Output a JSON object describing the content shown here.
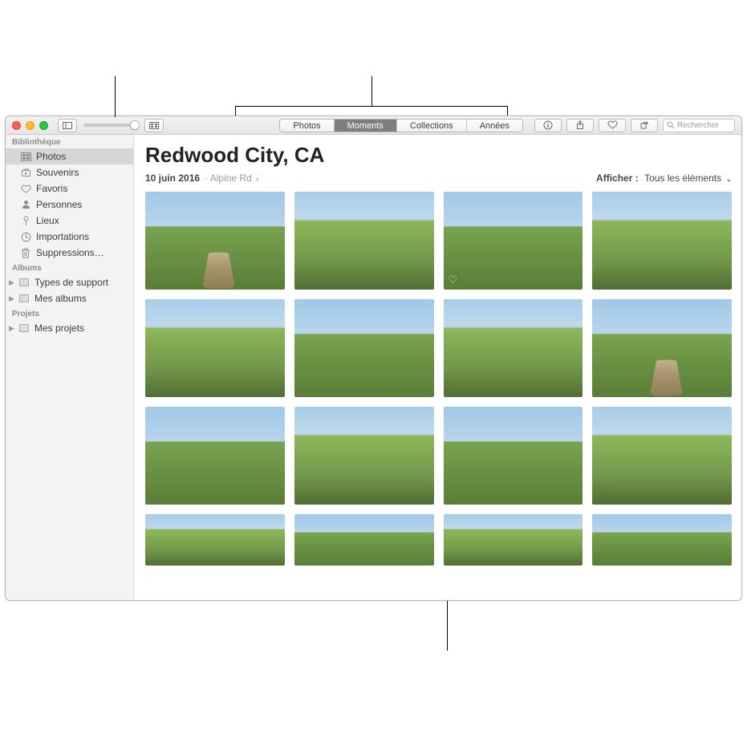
{
  "toolbar": {
    "segments": [
      "Photos",
      "Moments",
      "Collections",
      "Années"
    ],
    "active_segment": 1,
    "search_placeholder": "Rechercher",
    "right_icons": [
      "info-icon",
      "share-icon",
      "favorite-icon",
      "rotate-icon"
    ]
  },
  "sidebar": {
    "sections": [
      {
        "header": "Bibliothèque",
        "items": [
          {
            "label": "Photos",
            "icon": "photos-icon",
            "selected": true
          },
          {
            "label": "Souvenirs",
            "icon": "memories-icon"
          },
          {
            "label": "Favoris",
            "icon": "heart-icon"
          },
          {
            "label": "Personnes",
            "icon": "person-icon"
          },
          {
            "label": "Lieux",
            "icon": "pin-icon"
          },
          {
            "label": "Importations",
            "icon": "clock-icon"
          },
          {
            "label": "Suppressions…",
            "icon": "trash-icon"
          }
        ]
      },
      {
        "header": "Albums",
        "items": [
          {
            "label": "Types de support",
            "icon": "album-icon",
            "disclosure": true
          },
          {
            "label": "Mes albums",
            "icon": "album-icon",
            "disclosure": true
          }
        ]
      },
      {
        "header": "Projets",
        "items": [
          {
            "label": "Mes projets",
            "icon": "album-icon",
            "disclosure": true
          }
        ]
      }
    ]
  },
  "content": {
    "title": "Redwood City, CA",
    "date": "10 juin 2016",
    "place": "Alpine Rd",
    "display_label": "Afficher :",
    "display_value": "Tous les éléments",
    "favorited_index": 2,
    "thumb_count_full_rows": 12,
    "thumb_count_last_row": 4
  },
  "colors": {
    "toolbar_bg": "#ececec",
    "sidebar_bg": "#f3f3f3",
    "selection_bg": "#d6d6d6"
  }
}
